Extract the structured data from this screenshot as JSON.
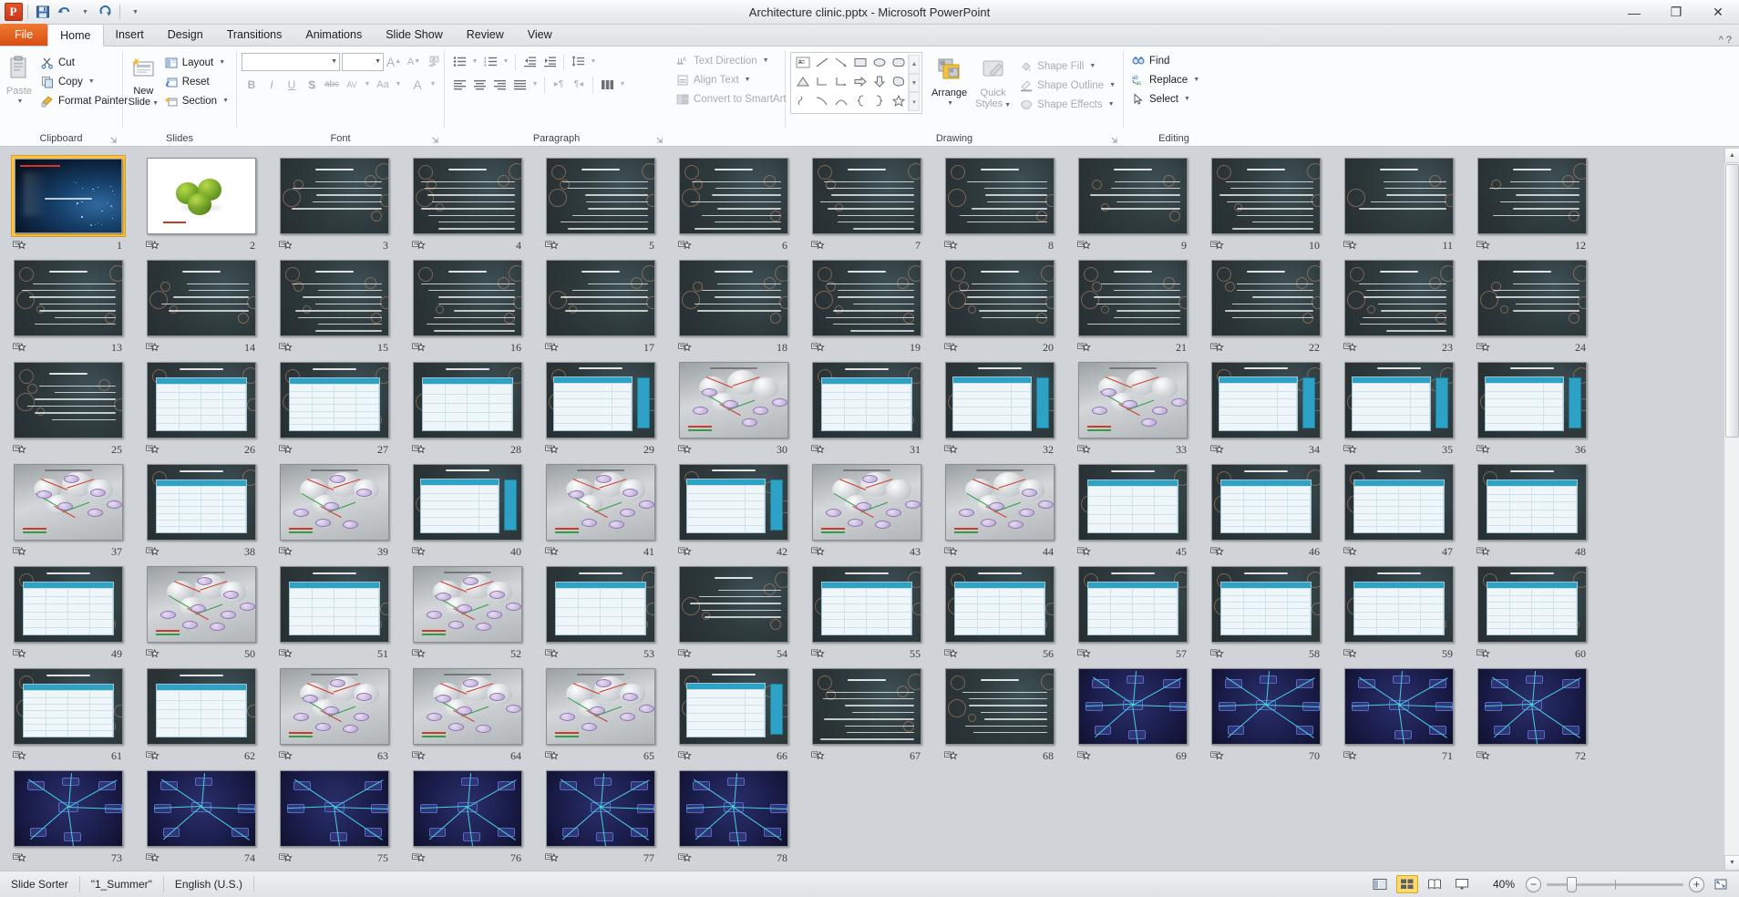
{
  "window": {
    "title": "Architecture clinic.pptx  -  Microsoft PowerPoint",
    "minimize": "—",
    "restore": "❐",
    "close": "✕"
  },
  "qat": {
    "logo": "P",
    "save_icon": "save-icon",
    "undo_icon": "undo-icon",
    "redo_icon": "redo-icon",
    "customize_icon": "chevron-down-icon"
  },
  "tabs": [
    {
      "label": "File",
      "active": false,
      "file": true
    },
    {
      "label": "Home",
      "active": true
    },
    {
      "label": "Insert",
      "active": false
    },
    {
      "label": "Design",
      "active": false
    },
    {
      "label": "Transitions",
      "active": false
    },
    {
      "label": "Animations",
      "active": false
    },
    {
      "label": "Slide Show",
      "active": false
    },
    {
      "label": "Review",
      "active": false
    },
    {
      "label": "View",
      "active": false
    }
  ],
  "ribbon": {
    "clipboard": {
      "label": "Clipboard",
      "paste": "Paste",
      "cut": "Cut",
      "copy": "Copy",
      "format_painter": "Format Painter"
    },
    "slides": {
      "label": "Slides",
      "new_slide_line1": "New",
      "new_slide_line2": "Slide",
      "layout": "Layout",
      "reset": "Reset",
      "section": "Section"
    },
    "font": {
      "label": "Font",
      "font_name": "",
      "font_size": "",
      "grow": "A",
      "shrink": "A",
      "clear_formatting": "clear-formatting-icon",
      "bold": "B",
      "italic": "I",
      "underline": "U",
      "shadow": "S",
      "strikethrough": "abc",
      "character_spacing": "AV",
      "change_case": "Aa",
      "font_color": "A"
    },
    "paragraph": {
      "label": "Paragraph",
      "bullets": "bullets-icon",
      "numbering": "numbering-icon",
      "decrease_indent": "decrease-indent-icon",
      "increase_indent": "increase-indent-icon",
      "line_spacing": "line-spacing-icon",
      "align_left": "align-left-icon",
      "align_center": "align-center-icon",
      "align_right": "align-right-icon",
      "justify": "justify-icon",
      "ltr": "ltr-icon",
      "rtl": "rtl-icon",
      "columns": "columns-icon",
      "text_direction": "Text Direction",
      "align_text": "Align Text",
      "convert_to_smartart": "Convert to SmartArt"
    },
    "drawing": {
      "label": "Drawing",
      "arrange_line1": "Arrange",
      "quick_styles_line1": "Quick",
      "quick_styles_line2": "Styles",
      "shape_fill": "Shape Fill",
      "shape_outline": "Shape Outline",
      "shape_effects": "Shape Effects",
      "shapes": [
        "textbox",
        "line",
        "arrow",
        "rectangle",
        "oval",
        "rounded-rect",
        "triangle",
        "elbow-connector",
        "elbow-arrow-connector",
        "right-arrow",
        "down-arrow",
        "pentagon-callout",
        "scribble",
        "curve",
        "arc",
        "left-brace",
        "right-brace",
        "star"
      ]
    },
    "editing": {
      "label": "Editing",
      "find": "Find",
      "replace": "Replace",
      "select": "Select"
    }
  },
  "slides": [
    {
      "n": 1,
      "kind": "title",
      "selected": true
    },
    {
      "n": 2,
      "kind": "apples",
      "selected": false
    },
    {
      "n": 3,
      "kind": "text",
      "selected": false
    },
    {
      "n": 4,
      "kind": "text",
      "selected": false
    },
    {
      "n": 5,
      "kind": "text",
      "selected": false
    },
    {
      "n": 6,
      "kind": "text",
      "selected": false
    },
    {
      "n": 7,
      "kind": "text",
      "selected": false
    },
    {
      "n": 8,
      "kind": "text",
      "selected": false
    },
    {
      "n": 9,
      "kind": "text",
      "selected": false
    },
    {
      "n": 10,
      "kind": "text",
      "selected": false
    },
    {
      "n": 11,
      "kind": "text",
      "selected": false
    },
    {
      "n": 12,
      "kind": "text",
      "selected": false
    },
    {
      "n": 13,
      "kind": "text",
      "selected": false
    },
    {
      "n": 14,
      "kind": "text",
      "selected": false
    },
    {
      "n": 15,
      "kind": "text",
      "selected": false
    },
    {
      "n": 16,
      "kind": "text",
      "selected": false
    },
    {
      "n": 17,
      "kind": "text",
      "selected": false
    },
    {
      "n": 18,
      "kind": "text",
      "selected": false
    },
    {
      "n": 19,
      "kind": "text",
      "selected": false
    },
    {
      "n": 20,
      "kind": "text",
      "selected": false
    },
    {
      "n": 21,
      "kind": "text",
      "selected": false
    },
    {
      "n": 22,
      "kind": "text",
      "selected": false
    },
    {
      "n": 23,
      "kind": "text",
      "selected": false
    },
    {
      "n": 24,
      "kind": "text",
      "selected": false
    },
    {
      "n": 25,
      "kind": "text",
      "selected": false
    },
    {
      "n": 26,
      "kind": "table",
      "selected": false
    },
    {
      "n": 27,
      "kind": "table",
      "selected": false
    },
    {
      "n": 28,
      "kind": "table",
      "selected": false
    },
    {
      "n": 29,
      "kind": "tablist",
      "selected": false
    },
    {
      "n": 30,
      "kind": "clouds",
      "selected": false
    },
    {
      "n": 31,
      "kind": "table",
      "selected": false
    },
    {
      "n": 32,
      "kind": "tablist",
      "selected": false
    },
    {
      "n": 33,
      "kind": "diagram",
      "selected": false
    },
    {
      "n": 34,
      "kind": "tablist",
      "selected": false
    },
    {
      "n": 35,
      "kind": "tablist",
      "selected": false
    },
    {
      "n": 36,
      "kind": "tablist",
      "selected": false
    },
    {
      "n": 37,
      "kind": "diagram",
      "selected": false
    },
    {
      "n": 38,
      "kind": "table",
      "selected": false
    },
    {
      "n": 39,
      "kind": "diagram",
      "selected": false
    },
    {
      "n": 40,
      "kind": "tablist",
      "selected": false
    },
    {
      "n": 41,
      "kind": "diagram",
      "selected": false
    },
    {
      "n": 42,
      "kind": "tablist",
      "selected": false
    },
    {
      "n": 43,
      "kind": "diagram",
      "selected": false
    },
    {
      "n": 44,
      "kind": "diagram",
      "selected": false
    },
    {
      "n": 45,
      "kind": "table",
      "selected": false
    },
    {
      "n": 46,
      "kind": "table",
      "selected": false
    },
    {
      "n": 47,
      "kind": "table",
      "selected": false
    },
    {
      "n": 48,
      "kind": "table",
      "selected": false
    },
    {
      "n": 49,
      "kind": "table",
      "selected": false
    },
    {
      "n": 50,
      "kind": "clouds",
      "selected": false
    },
    {
      "n": 51,
      "kind": "table",
      "selected": false
    },
    {
      "n": 52,
      "kind": "clouds",
      "selected": false
    },
    {
      "n": 53,
      "kind": "table",
      "selected": false
    },
    {
      "n": 54,
      "kind": "text",
      "selected": false
    },
    {
      "n": 55,
      "kind": "table",
      "selected": false
    },
    {
      "n": 56,
      "kind": "table",
      "selected": false
    },
    {
      "n": 57,
      "kind": "table",
      "selected": false
    },
    {
      "n": 58,
      "kind": "table",
      "selected": false
    },
    {
      "n": 59,
      "kind": "table",
      "selected": false
    },
    {
      "n": 60,
      "kind": "table",
      "selected": false
    },
    {
      "n": 61,
      "kind": "table",
      "selected": false
    },
    {
      "n": 62,
      "kind": "table",
      "selected": false
    },
    {
      "n": 63,
      "kind": "diagram",
      "selected": false
    },
    {
      "n": 64,
      "kind": "diagram",
      "selected": false
    },
    {
      "n": 65,
      "kind": "clouds",
      "selected": false
    },
    {
      "n": 66,
      "kind": "tablist",
      "selected": false
    },
    {
      "n": 67,
      "kind": "text",
      "selected": false
    },
    {
      "n": 68,
      "kind": "text",
      "selected": false
    },
    {
      "n": 69,
      "kind": "bdiag",
      "selected": false
    },
    {
      "n": 70,
      "kind": "bdiag",
      "selected": false
    },
    {
      "n": 71,
      "kind": "bdiag",
      "selected": false
    },
    {
      "n": 72,
      "kind": "bdiag",
      "selected": false
    },
    {
      "n": 73,
      "kind": "bdiag",
      "selected": false
    },
    {
      "n": 74,
      "kind": "bdiag",
      "selected": false
    },
    {
      "n": 75,
      "kind": "bdiag",
      "selected": false
    },
    {
      "n": 76,
      "kind": "bdiag",
      "selected": false
    },
    {
      "n": 77,
      "kind": "bdiag",
      "selected": false
    },
    {
      "n": 78,
      "kind": "bdiag",
      "selected": false
    }
  ],
  "status": {
    "view_mode": "Slide Sorter",
    "theme": "\"1_Summer\"",
    "language": "English (U.S.)",
    "zoom_percent": "40%",
    "zoom_out": "−",
    "zoom_in": "+",
    "views": [
      {
        "name": "normal-view-button",
        "active": false
      },
      {
        "name": "slide-sorter-view-button",
        "active": true
      },
      {
        "name": "reading-view-button",
        "active": false
      },
      {
        "name": "slide-show-button",
        "active": false
      }
    ],
    "fit_to_window": "fit-slide-to-window-icon"
  }
}
